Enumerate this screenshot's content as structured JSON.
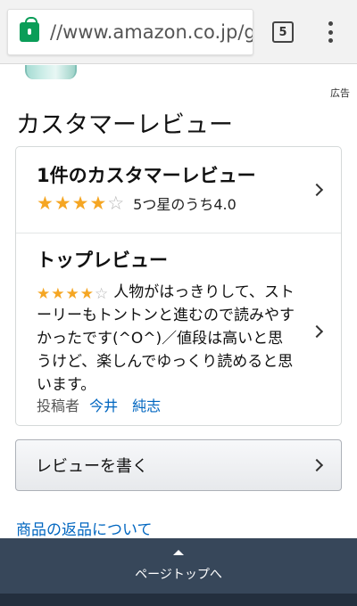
{
  "browser": {
    "url": "//www.amazon.co.jp/g",
    "tab_count": "5",
    "icons": [
      "lock-icon",
      "tab-switcher-icon",
      "overflow-menu-icon"
    ]
  },
  "ad_label": "広告",
  "section_title": "カスタマーレビュー",
  "summary": {
    "heading": "1件のカスタマーレビュー",
    "rating": 4.0,
    "rating_text": "5つ星のうち4.0"
  },
  "top_review": {
    "heading": "トップレビュー",
    "rating": 4,
    "body": "人物がはっきりして、ストーリーもトントンと進むので読みやすかったです(^O^)／値段は高いと思うけど、楽しんでゆっくり読めると思います。",
    "author_prefix": "投稿者",
    "author_name": "今井　純志"
  },
  "write_review_label": "レビューを書く",
  "return_link": "商品の返品について",
  "footer": {
    "back_to_top": "ページトップへ"
  },
  "colors": {
    "star": "#f5a623",
    "link": "#0066c0",
    "footer_bg": "#37475a",
    "lock": "#0b9d58"
  }
}
